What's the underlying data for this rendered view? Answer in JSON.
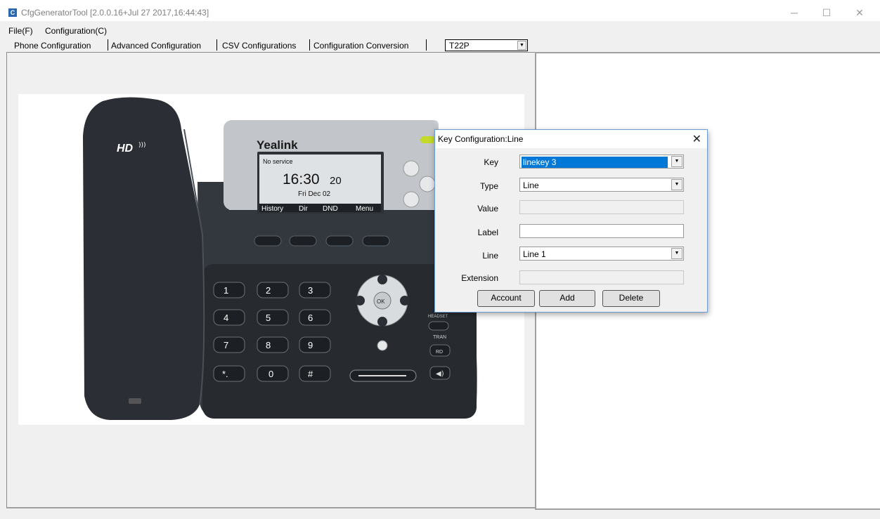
{
  "window": {
    "title": "CfgGeneratorTool [2.0.0.16+Jul 27 2017,16:44:43]",
    "icon": "C"
  },
  "menu": [
    "File(F)",
    "Configuration(C)"
  ],
  "tabs": [
    "Phone Configuration",
    "Advanced Configuration",
    "CSV Configurations",
    "Configuration Conversion"
  ],
  "model_select": {
    "value": "T22P"
  },
  "phone": {
    "hd_logo": "HD",
    "brand": "Yealink",
    "screen": {
      "status": "No service",
      "time": "16:30",
      "seconds": "20",
      "date": "Fri Dec 02",
      "softkeys": [
        "History",
        "Dir",
        "DND",
        "Menu"
      ]
    },
    "keys": [
      "1",
      "2",
      "3",
      "4",
      "5",
      "6",
      "7",
      "8",
      "9",
      "*.",
      "0",
      "#"
    ],
    "nav_center": "OK",
    "right_keys": [
      "HEADSET",
      "TRAN",
      "RD"
    ]
  },
  "dialog": {
    "title": "Key Configuration:Line",
    "fields": {
      "key": {
        "label": "Key",
        "value": "linekey 3"
      },
      "type": {
        "label": "Type",
        "value": "Line"
      },
      "value": {
        "label": "Value",
        "value": ""
      },
      "label": {
        "label": "Label",
        "value": ""
      },
      "line": {
        "label": "Line",
        "value": "Line 1"
      },
      "extension": {
        "label": "Extension",
        "value": ""
      }
    },
    "buttons": {
      "account": "Account",
      "add": "Add",
      "delete": "Delete"
    }
  },
  "colors": {
    "selection": "#0078d7",
    "app_icon": "#2a67b1",
    "phone_body": "#33383e"
  }
}
